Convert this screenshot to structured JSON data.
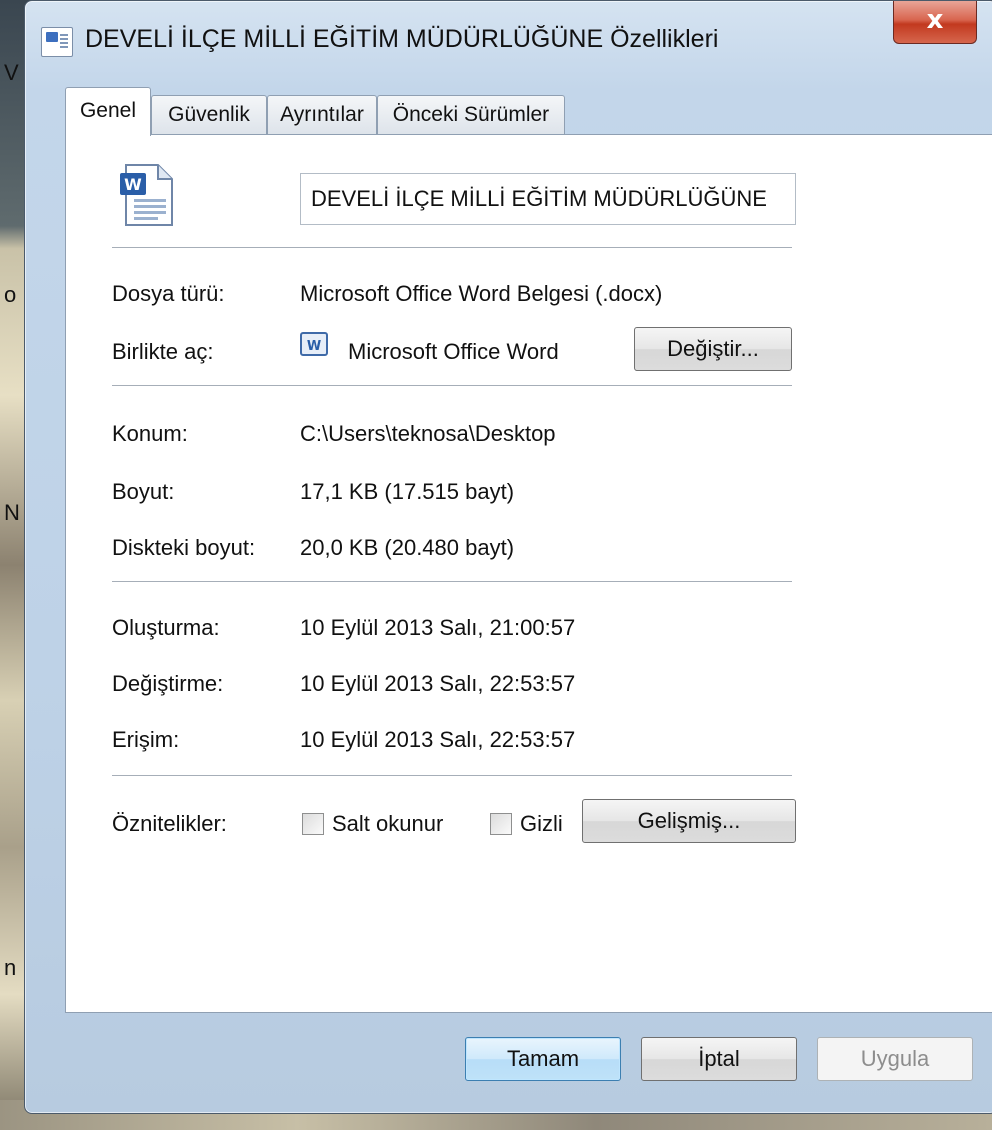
{
  "window": {
    "title": "DEVELİ İLÇE MİLLİ EĞİTİM MÜDÜRLÜĞÜNE Özellikleri",
    "close_label": "x"
  },
  "tabs": [
    {
      "label": "Genel",
      "active": true
    },
    {
      "label": "Güvenlik",
      "active": false
    },
    {
      "label": "Ayrıntılar",
      "active": false
    },
    {
      "label": "Önceki Sürümler",
      "active": false
    }
  ],
  "general": {
    "file_name": "DEVELİ İLÇE MİLLİ EĞİTİM MÜDÜRLÜĞÜNE",
    "file_icon": "word-document-icon",
    "type_label": "Dosya türü:",
    "type_value": "Microsoft Office Word Belgesi (.docx)",
    "open_with_label": "Birlikte aç:",
    "open_with_value": "Microsoft Office Word",
    "open_with_icon": "word-app-icon",
    "change_button": "Değiştir...",
    "location_label": "Konum:",
    "location_value": "C:\\Users\\teknosa\\Desktop",
    "size_label": "Boyut:",
    "size_value": "17,1 KB (17.515 bayt)",
    "disk_size_label": "Diskteki boyut:",
    "disk_size_value": "20,0 KB (20.480 bayt)",
    "created_label": "Oluşturma:",
    "created_value": "10 Eylül 2013 Salı, 21:00:57",
    "modified_label": "Değiştirme:",
    "modified_value": "10 Eylül 2013 Salı, 22:53:57",
    "accessed_label": "Erişim:",
    "accessed_value": "10 Eylül 2013 Salı, 22:53:57",
    "attributes_label": "Öznitelikler:",
    "readonly_label": "Salt okunur",
    "readonly_checked": false,
    "hidden_label": "Gizli",
    "hidden_checked": false,
    "advanced_button": "Gelişmiş..."
  },
  "footer": {
    "ok_label": "Tamam",
    "cancel_label": "İptal",
    "apply_label": "Uygula",
    "apply_enabled": false
  }
}
